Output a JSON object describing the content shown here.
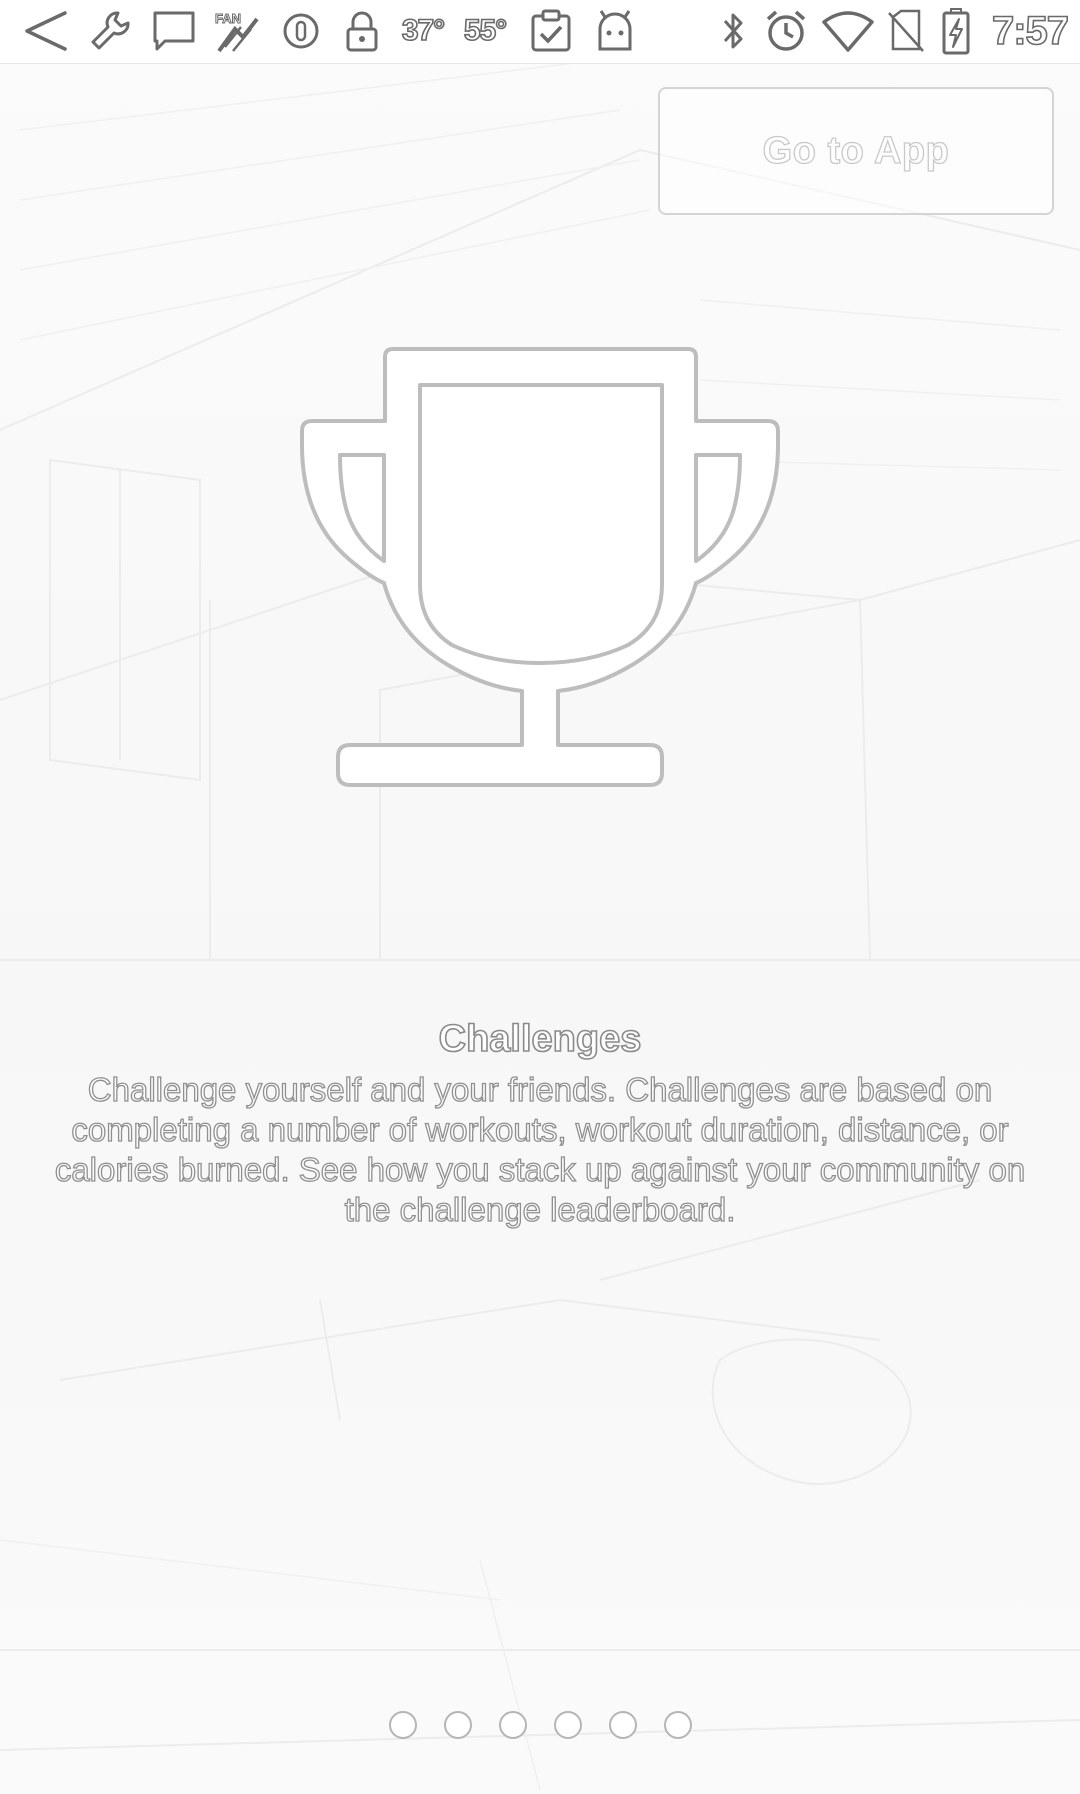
{
  "status_bar": {
    "temp_1": "37°",
    "temp_2": "55°",
    "time": "7:57",
    "icons": [
      "back-arrow-icon",
      "wrench-icon",
      "message-icon",
      "fantasy-icon",
      "circle-icon",
      "lock-icon",
      "clipboard-check-icon",
      "android-icon",
      "bluetooth-icon",
      "alarm-icon",
      "wifi-icon",
      "no-sim-icon",
      "battery-charging-icon"
    ]
  },
  "header": {
    "go_to_app_label": "Go to App"
  },
  "slide": {
    "icon": "trophy-icon",
    "title": "Challenges",
    "description": "Challenge yourself and your friends. Challenges are based on completing a number of workouts, workout duration, distance, or calories burned. See how you stack up against your community on the challenge leaderboard."
  },
  "pager": {
    "count": 6,
    "active_index": 0
  },
  "colors": {
    "outline": "#7a7a7a",
    "background": "#f8f8f8",
    "dot_border": "#b5b5b5"
  }
}
